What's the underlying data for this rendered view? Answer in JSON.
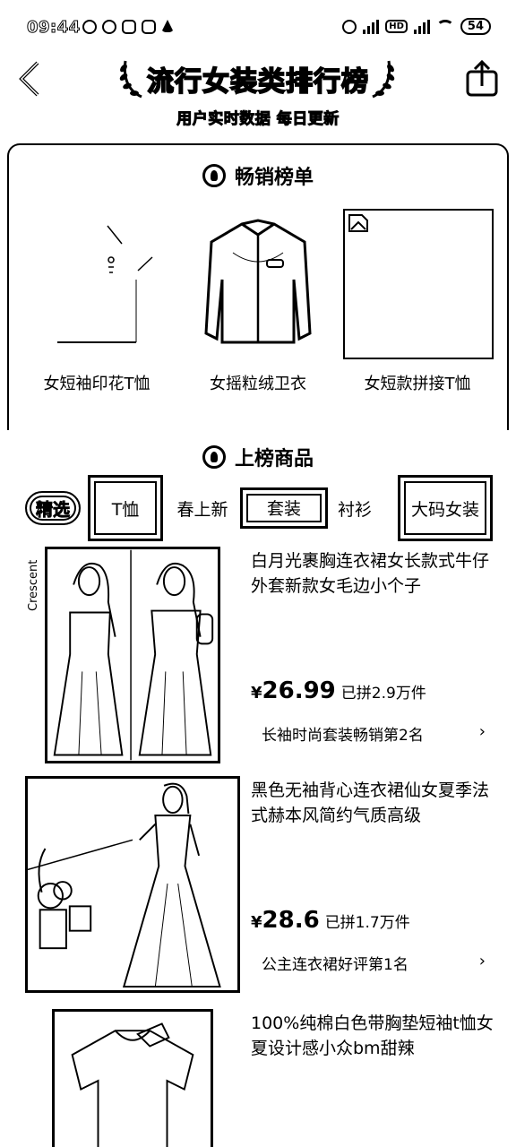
{
  "status_bar": {
    "time": "09:44",
    "battery": "54",
    "network_badge": "HD"
  },
  "header": {
    "title": "流行女装类排行榜",
    "subtitle": "用户实时数据 每日更新"
  },
  "bestseller": {
    "heading": "畅销榜单",
    "items": [
      {
        "label": "女短袖印花T恤"
      },
      {
        "label": "女摇粒绒卫衣"
      },
      {
        "label": "女短款拼接T恤"
      }
    ]
  },
  "listed": {
    "heading": "上榜商品"
  },
  "tabs": [
    {
      "label": "精选",
      "selected": true
    },
    {
      "label": "T恤"
    },
    {
      "label": "春上新"
    },
    {
      "label": "套装"
    },
    {
      "label": "衬衫"
    },
    {
      "label": "大码女装"
    }
  ],
  "products": [
    {
      "title": "白月光裹胸连衣裙女长款式牛仔外套新款女毛边小个子",
      "price_symbol": "¥",
      "price": "26.99",
      "sold": "已拼2.9万件",
      "rank": "长袖时尚套装畅销第2名",
      "side_text": "Crescent"
    },
    {
      "title": "黑色无袖背心连衣裙仙女夏季法式赫本风简约气质高级",
      "price_symbol": "¥",
      "price": "28.6",
      "sold": "已拼1.7万件",
      "rank": "公主连衣裙好评第1名"
    },
    {
      "title": "100%纯棉白色带胸垫短袖t恤女夏设计感小众bm甜辣"
    }
  ],
  "icons": {
    "back": "chevron-left-icon",
    "share": "share-icon",
    "rank_arrow": "chevron-right-icon"
  }
}
